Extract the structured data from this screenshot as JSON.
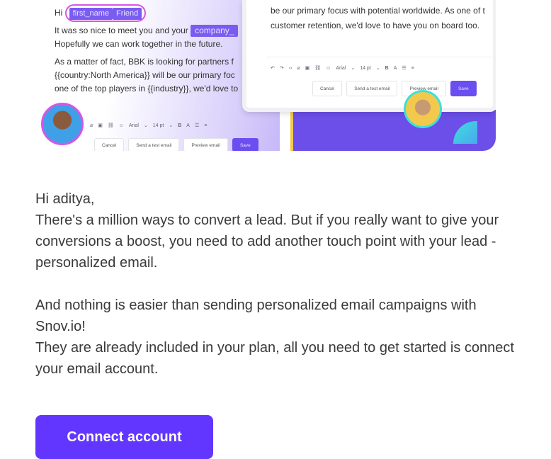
{
  "hero": {
    "left_card": {
      "greeting": "Hi",
      "chip_variable": "first_name",
      "chip_fallback": "Friend",
      "line2": "It was so nice to meet you and your",
      "chip_company": "company_",
      "line3": "Hopefully we can work together in the future.",
      "line4": "As a matter of fact, BBK is looking for partners f",
      "line5": "{{country:North America}} will be our primary foc",
      "line6": "one of the top players in {{industry}}, we'd love to",
      "font": "Arial",
      "size": "14 pt",
      "cancel": "Cancel",
      "send_test": "Send a test email",
      "preview": "Preview email",
      "save": "Save"
    },
    "right_card": {
      "line1": "be our primary focus with potential worldwide. As one of t",
      "line2": "customer retention, we'd love to have you on board too.",
      "font": "Arial",
      "size": "14 pt",
      "cancel": "Cancel",
      "send_test": "Send a test email",
      "preview": "Preview email",
      "save": "Save"
    },
    "colors": {
      "accent": "#6b4fe8",
      "highlight_ring": "#d556e6",
      "teal": "#3de0d8"
    }
  },
  "message": {
    "greeting": "Hi aditya,",
    "p1": "There's a million ways to convert a lead. But if you really want to give your conversions a boost, you need to add another touch point with your lead - personalized email.",
    "p2": "And nothing is easier than sending personalized email campaigns with Snov.io!",
    "p3": "They are already included in your plan, all you need to get started is connect your email account."
  },
  "cta": {
    "label": "Connect account",
    "color": "#6236ff"
  }
}
